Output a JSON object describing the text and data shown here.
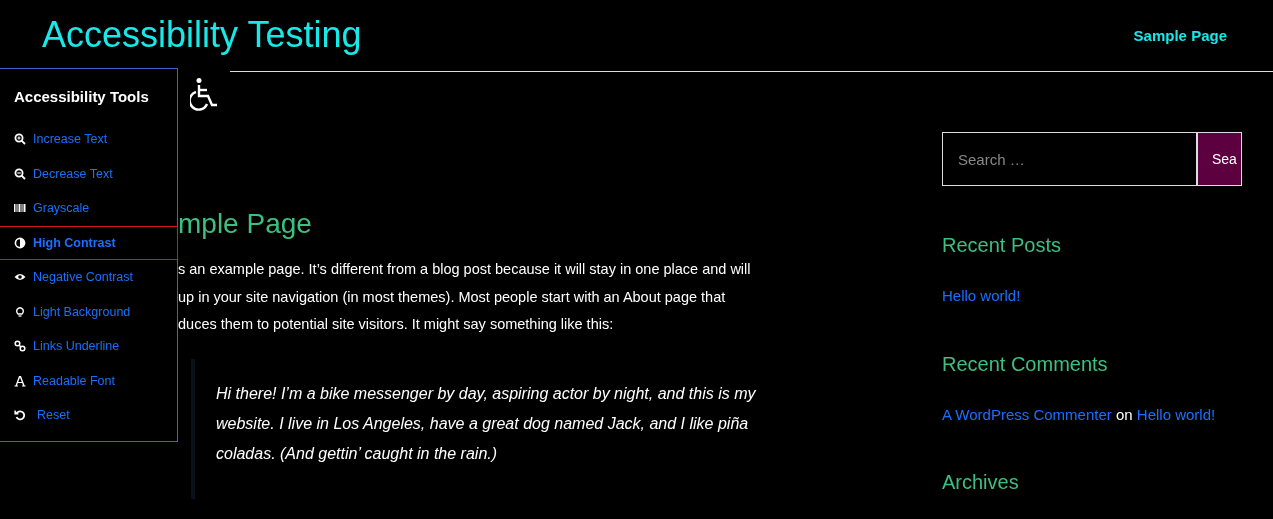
{
  "site_title": "Accessibility Testing",
  "nav": [
    {
      "label": "Sample Page"
    }
  ],
  "tools_panel": {
    "title": "Accessibility Tools",
    "items": [
      {
        "label": "Increase Text",
        "selected": false
      },
      {
        "label": "Decrease Text",
        "selected": false
      },
      {
        "label": "Grayscale",
        "selected": false
      },
      {
        "label": "High Contrast",
        "selected": true
      },
      {
        "label": "Negative Contrast",
        "selected": false
      },
      {
        "label": "Light Background",
        "selected": false
      },
      {
        "label": "Links Underline",
        "selected": false
      },
      {
        "label": "Readable Font",
        "selected": false
      },
      {
        "label": "Reset",
        "selected": false
      }
    ]
  },
  "article": {
    "title": "mple Page",
    "paragraph_lines": [
      "s an example page. It’s different from a blog post because it will stay in one place and will",
      "up in your site navigation (in most themes). Most people start with an About page that",
      "duces them to potential site visitors. It might say something like this:"
    ],
    "quote": "Hi there! I’m a bike messenger by day, aspiring actor by night, and this is my website. I live in Los Angeles, have a great dog named Jack, and I like piña coladas. (And gettin’ caught in the rain.)"
  },
  "sidebar": {
    "search": {
      "placeholder": "Search …",
      "button": "Sea"
    },
    "recent_posts": {
      "title": "Recent Posts",
      "items": [
        "Hello world!"
      ]
    },
    "recent_comments": {
      "title": "Recent Comments",
      "items": [
        {
          "author": "A WordPress Commenter",
          "joiner": "on",
          "post": "Hello world!"
        }
      ]
    },
    "archives": {
      "title": "Archives"
    }
  }
}
